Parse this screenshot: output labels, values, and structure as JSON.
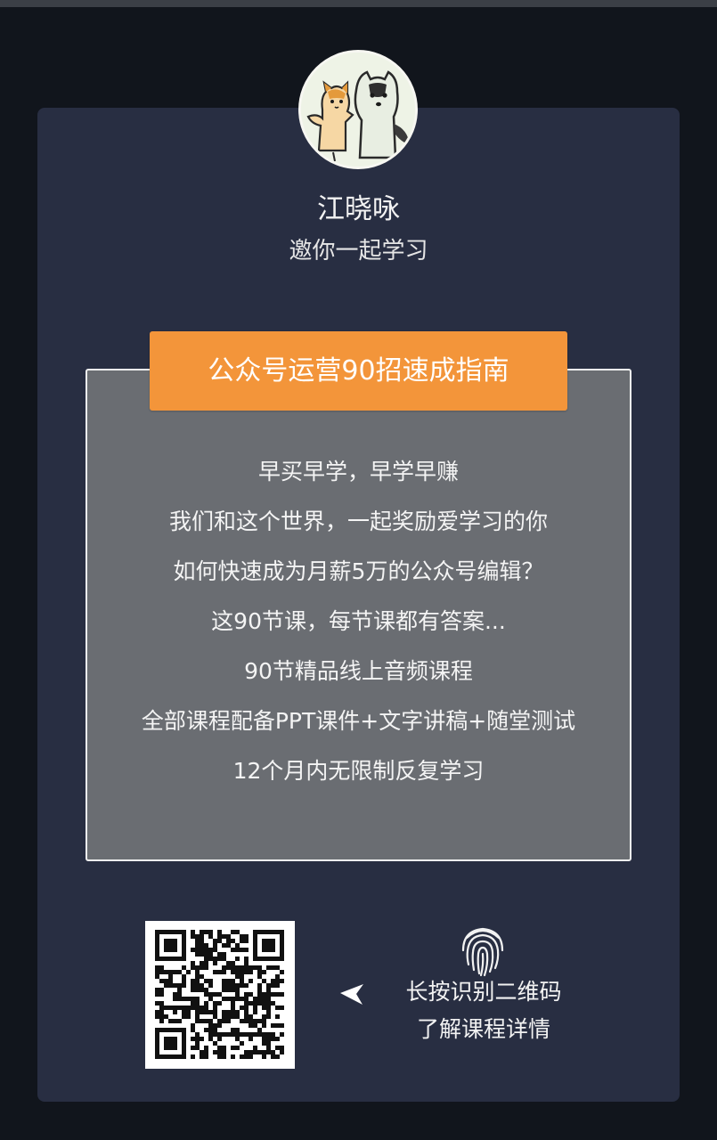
{
  "profile": {
    "name": "江晓咏",
    "invite": "邀你一起学习"
  },
  "course": {
    "title": "公众号运营90招速成指南",
    "features": [
      "早买早学，早学早赚",
      "我们和这个世界，一起奖励爱学习的你",
      "如何快速成为月薪5万的公众号编辑？",
      "这90节课，每节课都有答案...",
      "90节精品线上音频课程",
      "全部课程配备PPT课件+文字讲稿+随堂测试",
      "12个月内无限制反复学习"
    ]
  },
  "qr": {
    "hint_line1": "长按识别二维码",
    "hint_line2": "了解课程详情"
  },
  "colors": {
    "background": "#11151c",
    "card": "#282e42",
    "course_box": "#6a6d72",
    "title_accent": "#f3953a",
    "text": "#f2f2f2"
  },
  "icons": {
    "avatar": "cartoon-cat-and-husky-avatar",
    "arrow": "arrow-left-icon",
    "fingerprint": "fingerprint-icon",
    "qr": "qr-code"
  }
}
